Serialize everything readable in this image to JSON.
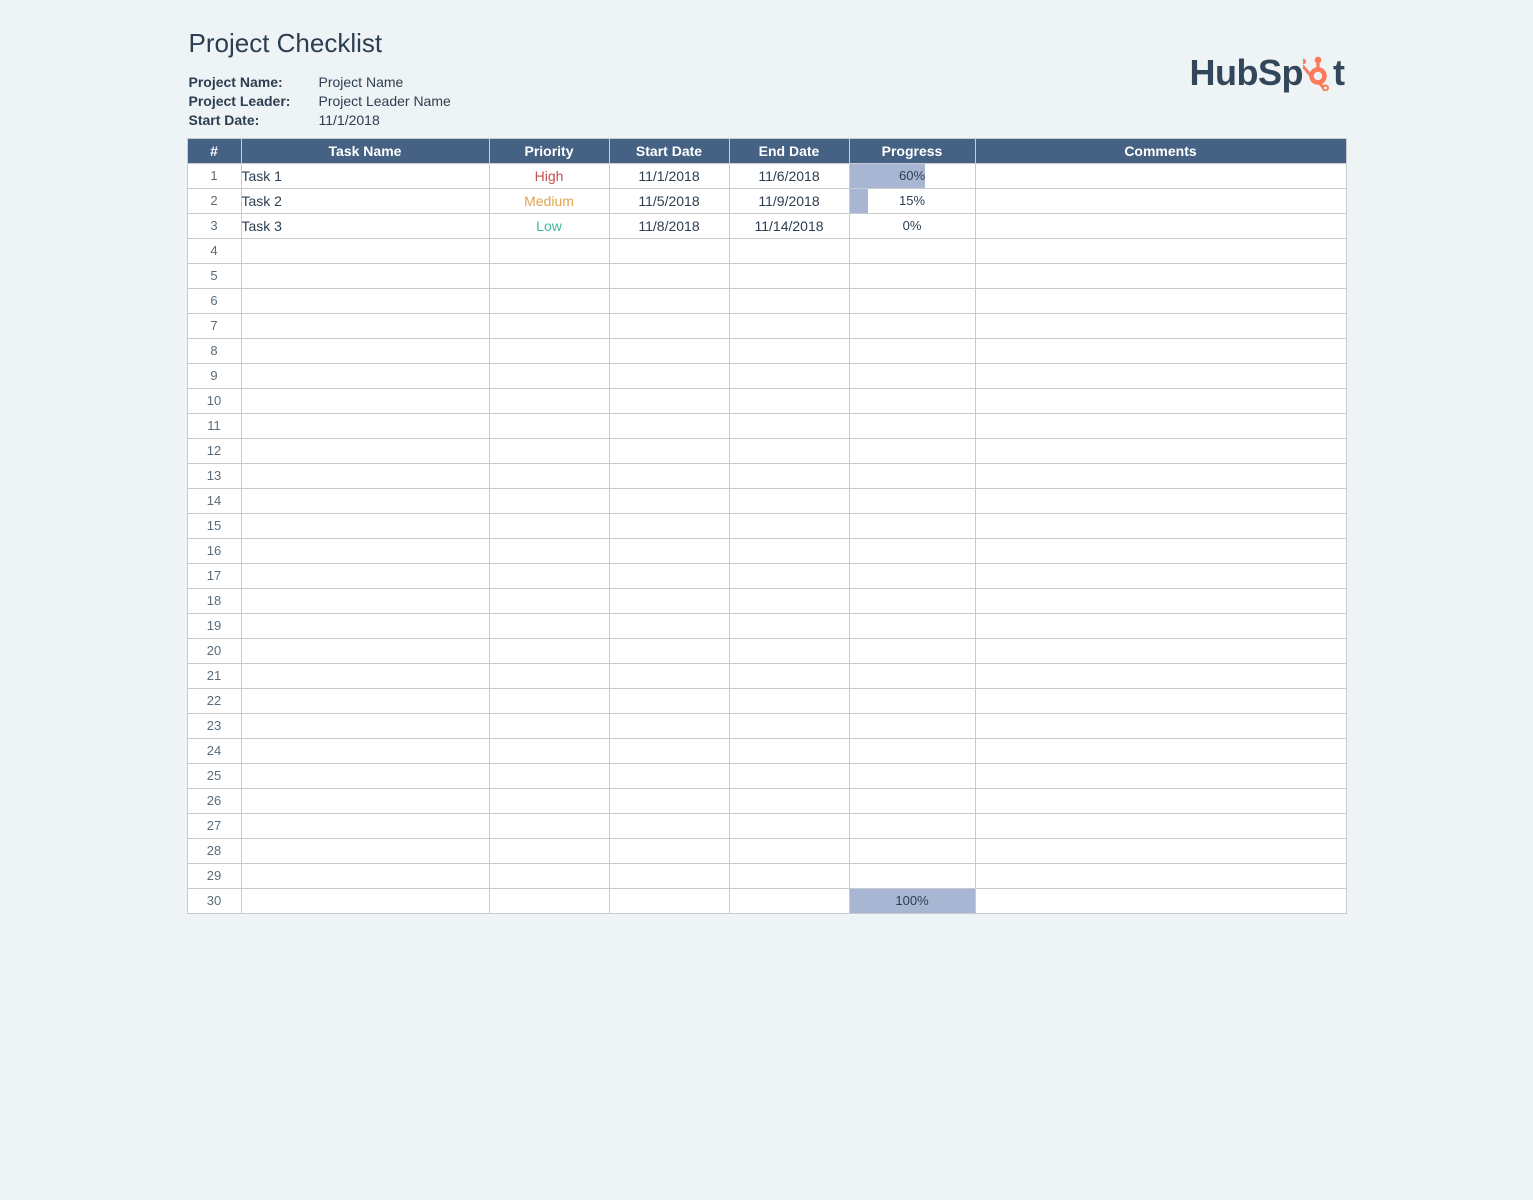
{
  "title": "Project Checklist",
  "meta": {
    "project_name_label": "Project Name:",
    "project_name_value": "Project Name",
    "project_leader_label": "Project Leader:",
    "project_leader_value": "Project Leader Name",
    "start_date_label": "Start Date:",
    "start_date_value": "11/1/2018"
  },
  "logo": {
    "text1": "HubSp",
    "text2": "t"
  },
  "columns": {
    "num": "#",
    "task": "Task Name",
    "priority": "Priority",
    "start": "Start Date",
    "end": "End Date",
    "progress": "Progress",
    "comments": "Comments"
  },
  "row_count": 30,
  "tasks": [
    {
      "num": 1,
      "name": "Task 1",
      "priority": "High",
      "start": "11/1/2018",
      "end": "11/6/2018",
      "progress": 60,
      "comments": ""
    },
    {
      "num": 2,
      "name": "Task 2",
      "priority": "Medium",
      "start": "11/5/2018",
      "end": "11/9/2018",
      "progress": 15,
      "comments": ""
    },
    {
      "num": 3,
      "name": "Task 3",
      "priority": "Low",
      "start": "11/8/2018",
      "end": "11/14/2018",
      "progress": 0,
      "comments": ""
    }
  ],
  "last_row_progress": 100
}
